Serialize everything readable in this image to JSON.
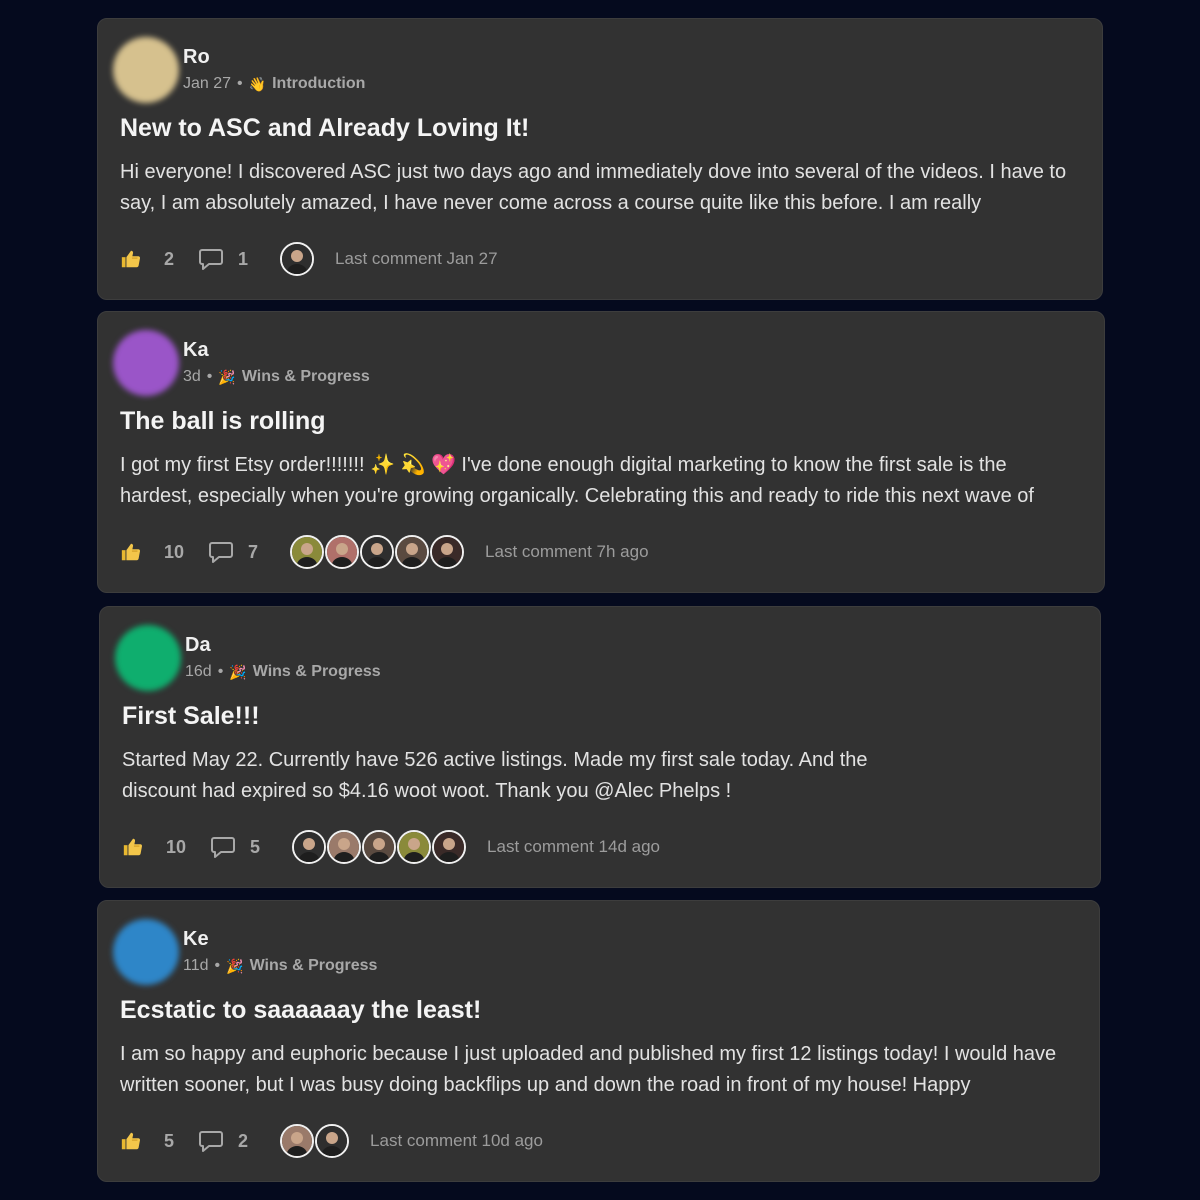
{
  "posts": [
    {
      "author": "Ro",
      "avatar_color": "#d6c18e",
      "time": "Jan 27",
      "category_emoji": "👋",
      "category": "Introduction",
      "title": "New to ASC and Already Loving It!",
      "body": "Hi everyone! I discovered ASC just two days ago and immediately dove into several of the videos. I have to say, I am absolutely amazed, I have never come across a course quite like this before. I am really",
      "likes": "2",
      "comments": "1",
      "commenter_colors": [
        "#2e2e2e"
      ],
      "last_comment": "Last comment Jan 27"
    },
    {
      "author": "Ka",
      "avatar_color": "#9a55c8",
      "time": "3d",
      "category_emoji": "🎉",
      "category": "Wins & Progress",
      "title": "The ball is rolling",
      "body": "I got my first Etsy order!!!!!!! ✨ 💫 💖 I've done enough digital marketing to know the first sale is the hardest, especially when you're growing organically. Celebrating this and ready to ride this next wave of",
      "likes": "10",
      "comments": "7",
      "commenter_colors": [
        "#8a8a3a",
        "#b0706a",
        "#2e2e2e",
        "#5a4a40",
        "#3a2a28"
      ],
      "last_comment": "Last comment 7h ago"
    },
    {
      "author": "Da",
      "avatar_color": "#0fae6e",
      "time": "16d",
      "category_emoji": "🎉",
      "category": "Wins & Progress",
      "title": "First Sale!!!",
      "body": "Started May 22. Currently have 526 active listings. Made my first sale today. And the discount had expired so $4.16 woot woot. Thank you @Alec Phelps !",
      "likes": "10",
      "comments": "5",
      "commenter_colors": [
        "#2e2e2e",
        "#9a7a6a",
        "#5a4a40",
        "#8a8a3a",
        "#3a2a28"
      ],
      "last_comment": "Last comment 14d ago"
    },
    {
      "author": "Ke",
      "avatar_color": "#2e86c8",
      "time": "11d",
      "category_emoji": "🎉",
      "category": "Wins & Progress",
      "title": "Ecstatic to saaaaaay the least!",
      "body": "I am so happy and euphoric because I just uploaded and published my first 12 listings today! I would have written sooner, but I was busy doing backflips up and down the road in front of my house! Happy",
      "likes": "5",
      "comments": "2",
      "commenter_colors": [
        "#9a7a6a",
        "#2e2e2e"
      ],
      "last_comment": "Last comment 10d ago"
    }
  ]
}
